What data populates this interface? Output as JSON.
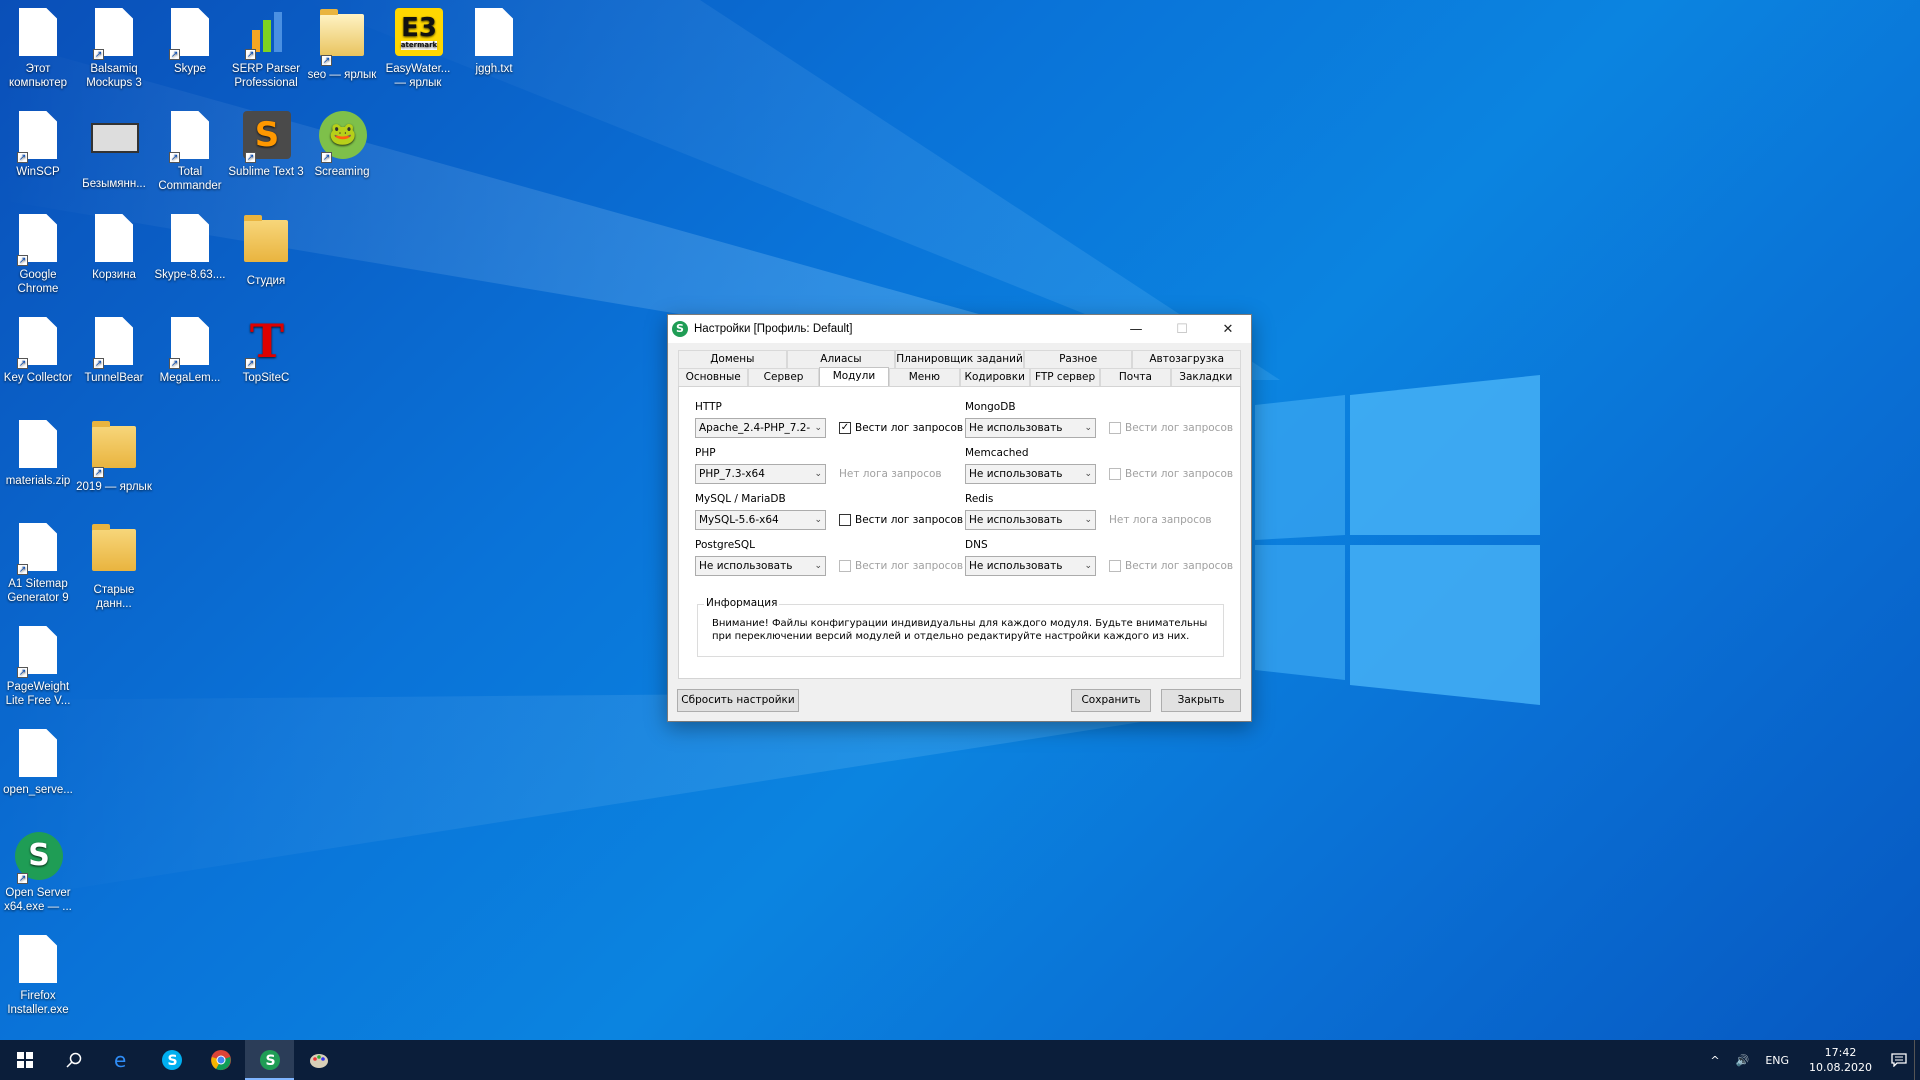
{
  "desktop": {
    "icons": [
      {
        "label": "Этот компьютер"
      },
      {
        "label": "Balsamiq Mockups 3"
      },
      {
        "label": "Skype"
      },
      {
        "label": "SERP Parser Professional"
      },
      {
        "label": "seo — ярлык"
      },
      {
        "label": "EasyWater... — ярлык"
      },
      {
        "label": "jggh.txt"
      },
      {
        "label": "WinSCP"
      },
      {
        "label": "Безымянн..."
      },
      {
        "label": "Total Commander"
      },
      {
        "label": "Sublime Text 3"
      },
      {
        "label": "Screaming"
      },
      {
        "label": "Google Chrome"
      },
      {
        "label": "Корзина"
      },
      {
        "label": "Skype-8.63...."
      },
      {
        "label": "Студия"
      },
      {
        "label": "Key Collector"
      },
      {
        "label": "TunnelBear"
      },
      {
        "label": "MegaLem..."
      },
      {
        "label": "TopSiteC"
      },
      {
        "label": "materials.zip"
      },
      {
        "label": "2019 — ярлык"
      },
      {
        "label": "A1 Sitemap Generator 9"
      },
      {
        "label": "Старые данн..."
      },
      {
        "label": "PageWeight Lite Free V..."
      },
      {
        "label": "open_serve..."
      },
      {
        "label": "Open Server x64.exe — ..."
      },
      {
        "label": "Firefox Installer.exe"
      }
    ],
    "easywater_tile_text": "atermark",
    "topsite_glyph": "T"
  },
  "dialog": {
    "icon_letter": "S",
    "title": "Настройки [Профиль: Default]",
    "min_glyph": "—",
    "max_glyph": "☐",
    "close_glyph": "✕",
    "tabs_row1": [
      "Домены",
      "Алиасы",
      "Планировщик заданий",
      "Разное",
      "Автозагрузка"
    ],
    "tabs_row2": [
      "Основные",
      "Сервер",
      "Модули",
      "Меню",
      "Кодировки",
      "FTP сервер",
      "Почта",
      "Закладки"
    ],
    "active_tab": "Модули",
    "modules": {
      "http_label": "HTTP",
      "http_value": "Apache_2.4-PHP_7.2-",
      "http_log": "Вести лог запросов",
      "php_label": "PHP",
      "php_value": "PHP_7.3-x64",
      "php_log": "Нет лога запросов",
      "mysql_label": "MySQL / MariaDB",
      "mysql_value": "MySQL-5.6-x64",
      "mysql_log": "Вести лог запросов",
      "pgsql_label": "PostgreSQL",
      "pgsql_value": "Не использовать",
      "pgsql_log": "Вести лог запросов",
      "mongo_label": "MongoDB",
      "mongo_value": "Не использовать",
      "mongo_log": "Вести лог запросов",
      "memcached_label": "Memcached",
      "memcached_value": "Не использовать",
      "memcached_log": "Вести лог запросов",
      "redis_label": "Redis",
      "redis_value": "Не использовать",
      "redis_log": "Нет лога запросов",
      "dns_label": "DNS",
      "dns_value": "Не использовать",
      "dns_log": "Вести лог запросов"
    },
    "info": {
      "legend": "Информация",
      "text": "Внимание! Файлы конфигурации индивидуальны для каждого модуля. Будьте внимательны при переключении версий модулей и отдельно редактируйте настройки каждого из них."
    },
    "buttons": {
      "reset": "Сбросить настройки",
      "save": "Сохранить",
      "close": "Закрыть"
    }
  },
  "taskbar": {
    "lang": "ENG",
    "time": "17:42",
    "date": "10.08.2020",
    "tray_up": "^",
    "volume": "🔊"
  }
}
